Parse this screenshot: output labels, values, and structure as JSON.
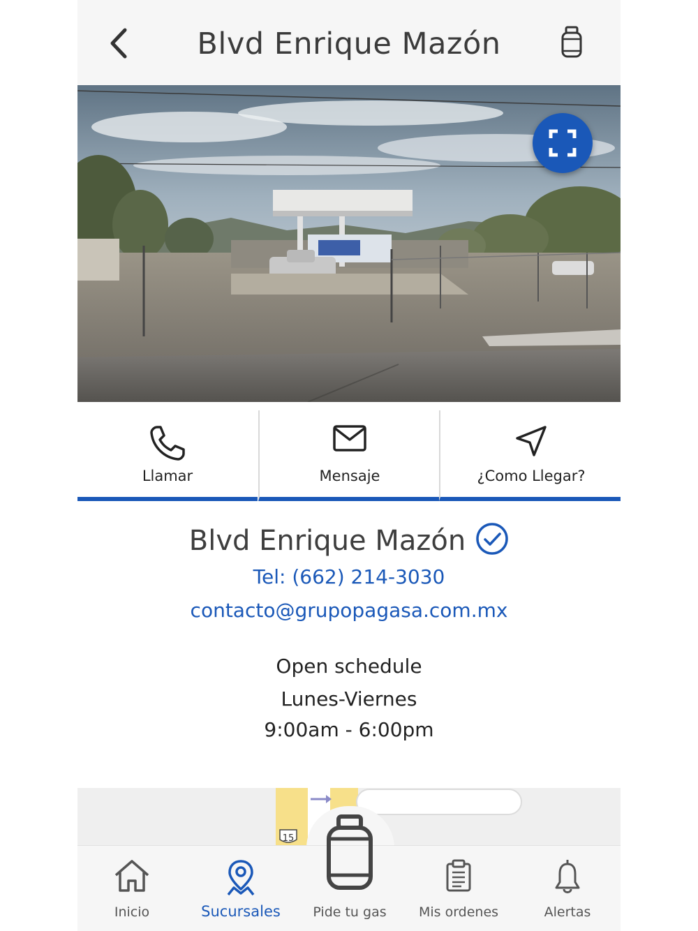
{
  "header": {
    "title": "Blvd Enrique Mazón",
    "back_icon": "chevron-left-icon",
    "tank_icon": "gas-tank-icon"
  },
  "photo": {
    "fullscreen_icon": "fullscreen-icon"
  },
  "actions": [
    {
      "label": "Llamar",
      "icon": "phone-icon"
    },
    {
      "label": "Mensaje",
      "icon": "mail-icon"
    },
    {
      "label": "¿Como Llegar?",
      "icon": "navigation-icon"
    }
  ],
  "branch": {
    "name": "Blvd Enrique Mazón",
    "tel": "Tel: (662) 214-3030",
    "email": "contacto@grupopagasa.com.mx",
    "schedule_title": "Open schedule",
    "schedule_days": "Lunes-Viernes",
    "schedule_hours": "9:00am - 6:00pm"
  },
  "map": {
    "highway_label": "15"
  },
  "nav": [
    {
      "label": "Inicio",
      "icon": "home-icon"
    },
    {
      "label": "Sucursales",
      "icon": "location-pin-icon",
      "active": true
    },
    {
      "label": "Pide tu gas",
      "icon": "gas-cylinder-icon"
    },
    {
      "label": "Mis ordenes",
      "icon": "clipboard-icon"
    },
    {
      "label": "Alertas",
      "icon": "bell-icon"
    }
  ],
  "colors": {
    "accent": "#1a58b8",
    "header_bg": "#f6f6f6",
    "text": "#333333"
  }
}
